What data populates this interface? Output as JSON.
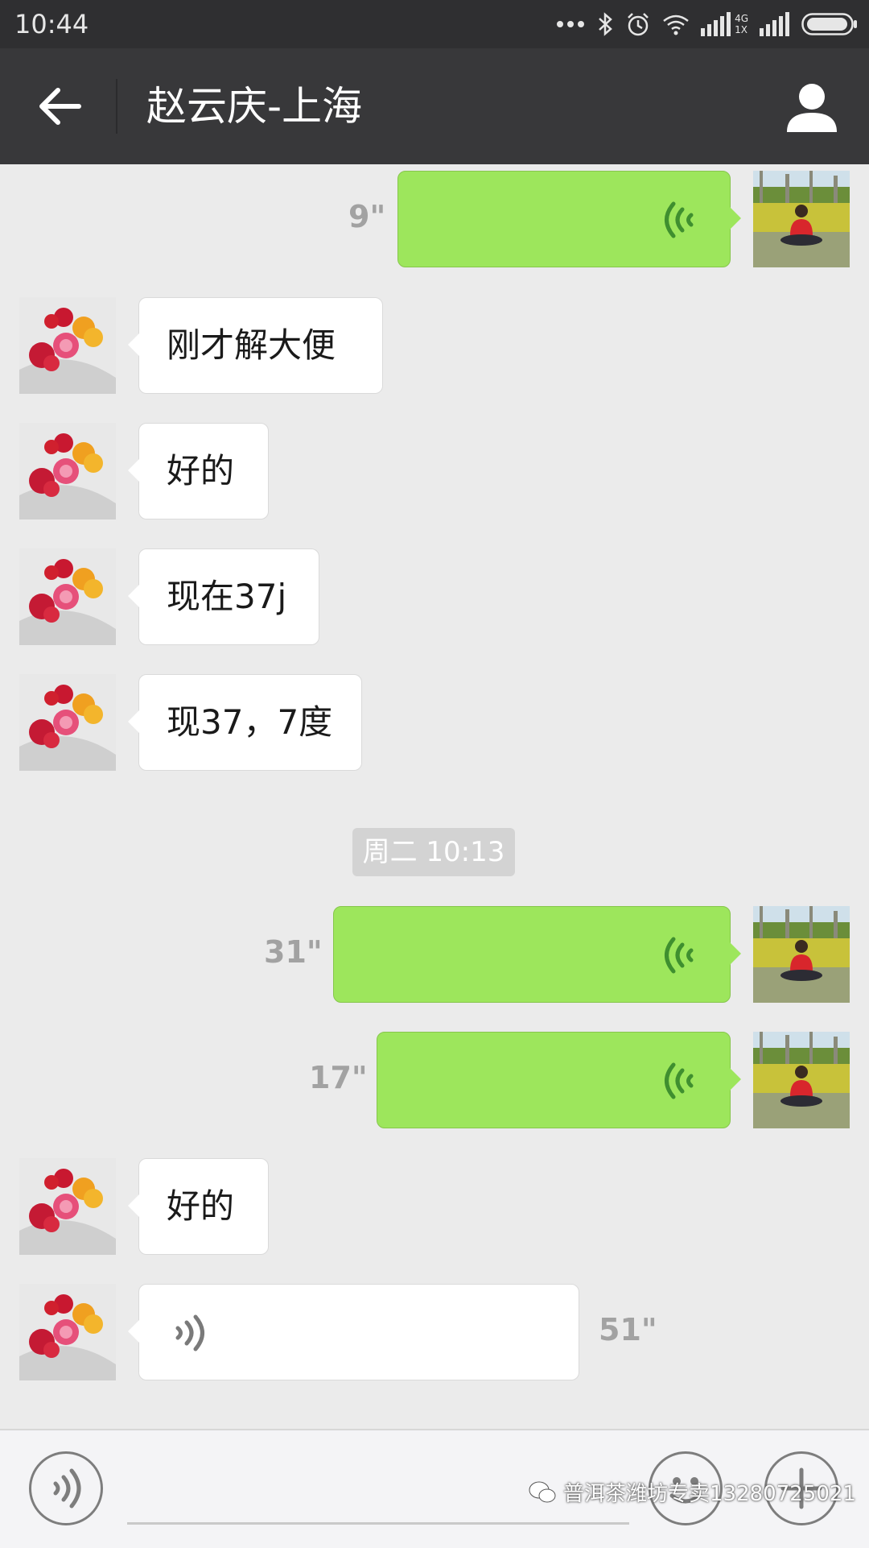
{
  "status_bar": {
    "time": "10:44",
    "network_top": "4G",
    "network_bottom": "1X",
    "icons": [
      "more-dots-icon",
      "bluetooth-icon",
      "alarm-icon",
      "wifi-icon",
      "signal-icon",
      "battery-icon"
    ]
  },
  "header": {
    "title": "赵云庆-上海",
    "back_icon": "arrow-left-icon",
    "profile_icon": "person-icon"
  },
  "messages": [
    {
      "side": "out",
      "type": "voice",
      "duration": "9\""
    },
    {
      "side": "in",
      "type": "text",
      "text": "刚才解大便"
    },
    {
      "side": "in",
      "type": "text",
      "text": "好的"
    },
    {
      "side": "in",
      "type": "text",
      "text": "现在37j"
    },
    {
      "side": "in",
      "type": "text",
      "text": "现37，7度"
    },
    {
      "side": "out",
      "type": "voice",
      "duration": "31\""
    },
    {
      "side": "out",
      "type": "voice",
      "duration": "17\""
    },
    {
      "side": "in",
      "type": "text",
      "text": "好的"
    },
    {
      "side": "in",
      "type": "voice",
      "duration": "51\""
    }
  ],
  "timestamp": "周二 10:13",
  "input_bar": {
    "voice_icon": "voice-mode-icon",
    "emoji_icon": "emoji-icon",
    "plus_icon": "plus-icon"
  },
  "watermark": "普洱茶潍坊专卖13280725021",
  "colors": {
    "nav_bg": "#38383a",
    "status_bg": "#2f2f31",
    "chat_bg": "#ebebeb",
    "outgoing_bubble": "#9de65c",
    "incoming_bubble": "#ffffff",
    "voice_wave_out": "#3f8f2f"
  }
}
